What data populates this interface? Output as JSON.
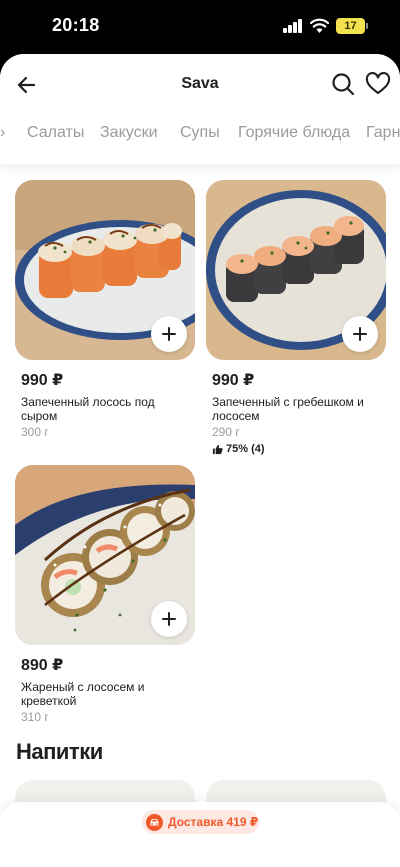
{
  "status": {
    "time": "20:18",
    "battery": "17"
  },
  "header": {
    "title": "Sava"
  },
  "tabs": [
    "›",
    "Салаты",
    "Закуски",
    "Супы",
    "Горячие блюда",
    "Гарн"
  ],
  "products": [
    {
      "price": "990 ₽",
      "name": "Запеченный лосось под сыром",
      "weight": "300 г"
    },
    {
      "price": "990 ₽",
      "name": "Запеченный с гребешком и лососем",
      "weight": "290 г",
      "rating": "75% (4)"
    },
    {
      "price": "890 ₽",
      "name": "Жареный с лососем и креветкой",
      "weight": "310 г"
    }
  ],
  "section": {
    "title": "Напитки"
  },
  "delivery": {
    "label": "Доставка 419 ₽"
  },
  "colors": {
    "accent": "#f05a2a",
    "muted": "#9b9b9b"
  }
}
